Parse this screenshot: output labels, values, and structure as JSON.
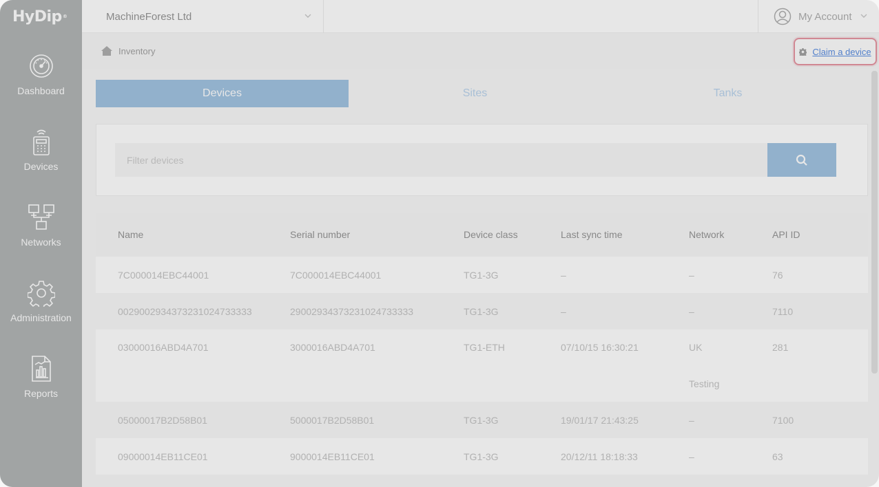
{
  "app": {
    "logo": "HyDip",
    "logo_mark": "®"
  },
  "sidebar": {
    "items": [
      {
        "label": "Dashboard",
        "icon": "gauge-icon"
      },
      {
        "label": "Devices",
        "icon": "device-icon"
      },
      {
        "label": "Networks",
        "icon": "network-icon"
      },
      {
        "label": "Administration",
        "icon": "gear-icon"
      },
      {
        "label": "Reports",
        "icon": "report-icon"
      }
    ]
  },
  "topbar": {
    "organisation": "MachineForest Ltd",
    "account_label": "My Account"
  },
  "breadcrumb": {
    "label": "Inventory"
  },
  "claim": {
    "label": "Claim a device"
  },
  "tabs": [
    {
      "label": "Devices",
      "active": true
    },
    {
      "label": "Sites",
      "active": false
    },
    {
      "label": "Tanks",
      "active": false
    }
  ],
  "filter": {
    "placeholder": "Filter devices"
  },
  "table": {
    "headers": [
      "Name",
      "Serial number",
      "Device class",
      "Last sync time",
      "Network",
      "API ID"
    ],
    "rows": [
      {
        "name": "7C000014EBC44001",
        "serial": "7C000014EBC44001",
        "class": "TG1-3G",
        "sync": "–",
        "network": "–",
        "network2": "",
        "api": "76"
      },
      {
        "name": "0029002934373231024733333",
        "serial": "290029343732310247333​33",
        "class": "TG1-3G",
        "sync": "–",
        "network": "–",
        "network2": "",
        "api": "7110"
      },
      {
        "name": "03000016ABD4A701",
        "serial": "3000016ABD4A701",
        "class": "TG1-ETH",
        "sync": "07/10/15 16:30:21",
        "network": "UK",
        "network2": "Testing",
        "api": "281"
      },
      {
        "name": "05000017B2D58B01",
        "serial": "5000017B2D58B01",
        "class": "TG1-3G",
        "sync": "19/01/17 21:43:25",
        "network": "–",
        "network2": "",
        "api": "7100"
      },
      {
        "name": "09000014EB11CE01",
        "serial": "9000014EB11CE01",
        "class": "TG1-3G",
        "sync": "20/12/11 18:18:33",
        "network": "–",
        "network2": "",
        "api": "63"
      }
    ]
  },
  "colors": {
    "sidebar": "#9fa3a3",
    "accent": "#8ab4da",
    "highlight": "#e07a8a",
    "link": "#2f6fd8"
  }
}
